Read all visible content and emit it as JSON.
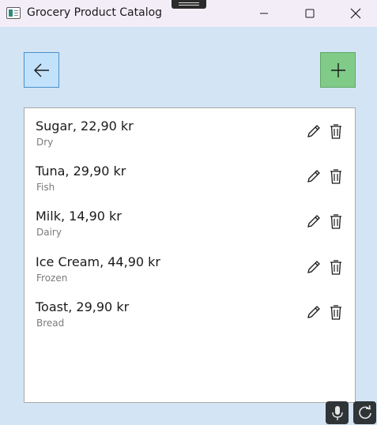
{
  "window": {
    "title": "Grocery Product Catalog"
  },
  "products": [
    {
      "name": "Sugar, 22,90 kr",
      "category": "Dry"
    },
    {
      "name": "Tuna, 29,90 kr",
      "category": "Fish"
    },
    {
      "name": "Milk, 14,90 kr",
      "category": "Dairy"
    },
    {
      "name": "Ice Cream, 44,90 kr",
      "category": "Frozen"
    },
    {
      "name": "Toast, 29,90 kr",
      "category": "Bread"
    }
  ],
  "colors": {
    "background": "#d3e4f4",
    "back_button": "#c2e2fb",
    "add_button": "#7fcb87",
    "titlebar": "#f3edf8"
  },
  "icons": {
    "back": "arrow-left-icon",
    "add": "plus-icon",
    "edit": "pencil-icon",
    "delete": "trash-icon",
    "mic": "microphone-icon",
    "sync": "refresh-icon"
  }
}
